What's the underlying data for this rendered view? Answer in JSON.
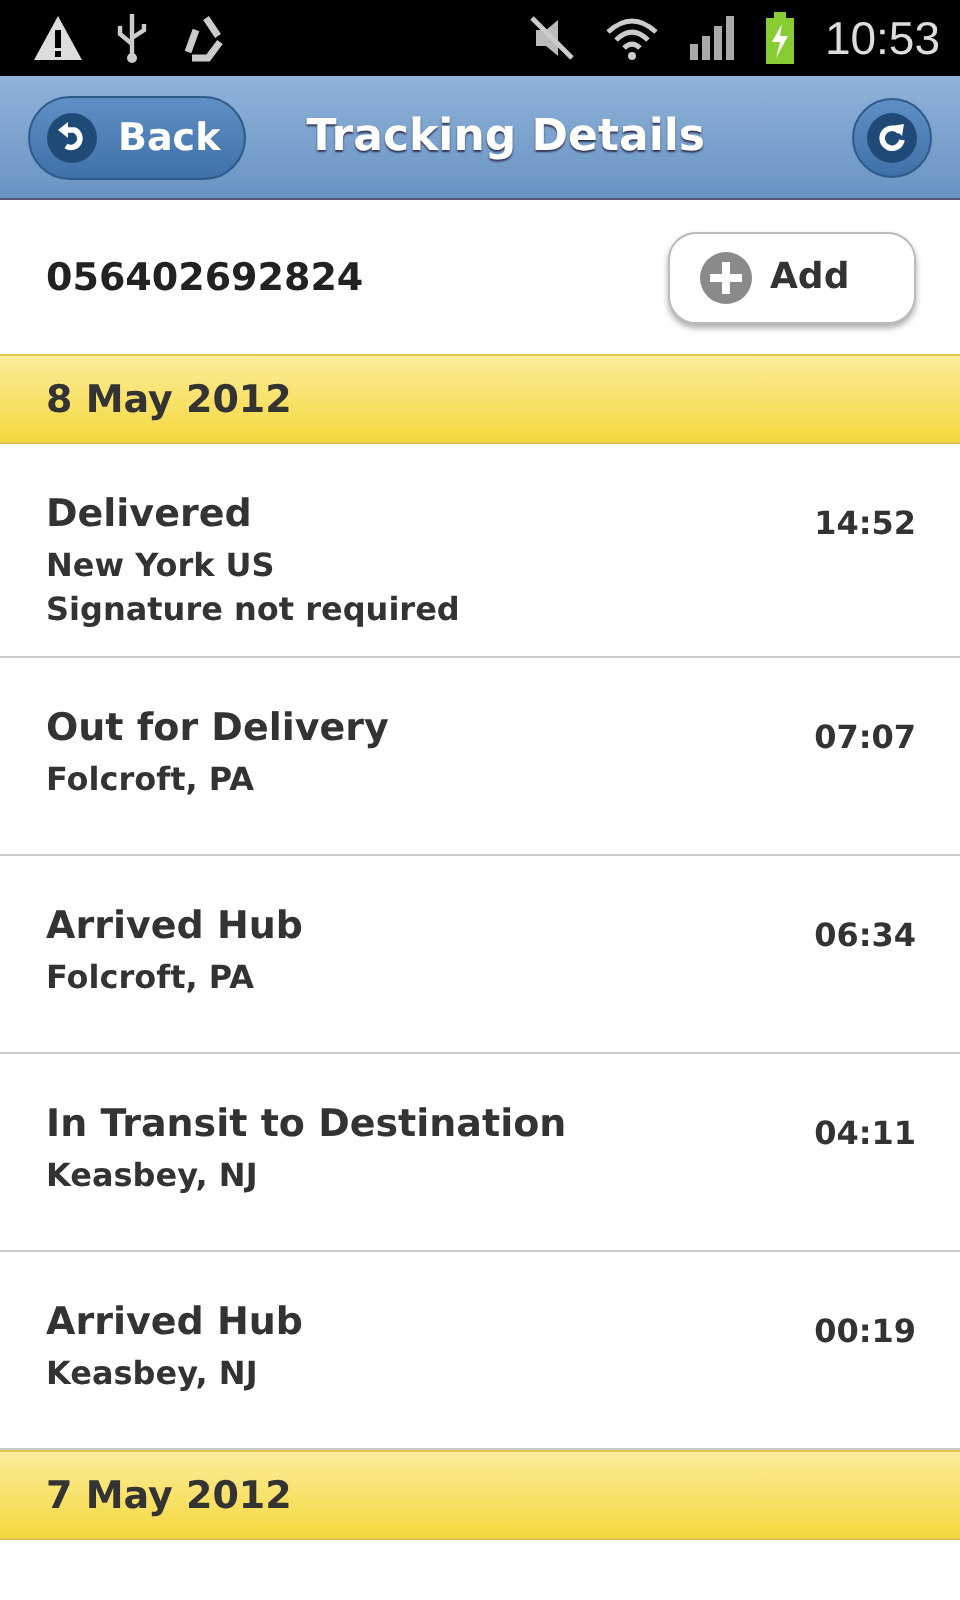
{
  "status_bar": {
    "time": "10:53"
  },
  "header": {
    "back_label": "Back",
    "title": "Tracking Details"
  },
  "tracking": {
    "number": "056402692824",
    "add_label": "Add"
  },
  "days": [
    {
      "date": "8 May 2012",
      "events": [
        {
          "status": "Delivered",
          "time": "14:52",
          "lines": [
            "New York US",
            "Signature not required"
          ]
        },
        {
          "status": "Out for Delivery",
          "time": "07:07",
          "lines": [
            "Folcroft, PA"
          ]
        },
        {
          "status": "Arrived Hub",
          "time": "06:34",
          "lines": [
            "Folcroft, PA"
          ]
        },
        {
          "status": "In Transit to Destination",
          "time": "04:11",
          "lines": [
            "Keasbey, NJ"
          ]
        },
        {
          "status": "Arrived Hub",
          "time": "00:19",
          "lines": [
            "Keasbey, NJ"
          ]
        }
      ]
    },
    {
      "date": "7 May 2012"
    }
  ]
}
